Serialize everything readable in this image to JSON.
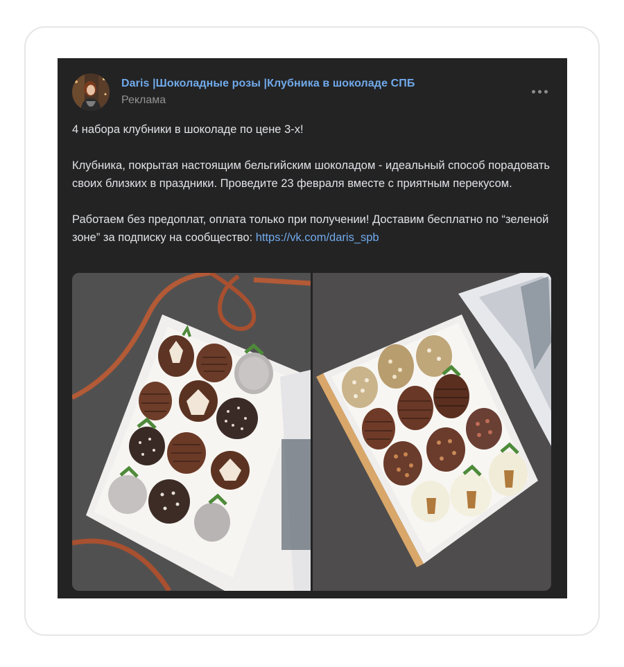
{
  "post": {
    "author": "Daris |Шоколадные розы |Клубника в шоколаде СПБ",
    "ad_label": "Реклама",
    "menu_icon": "more-horizontal-icon",
    "paragraph1": "4 набора клубники в шоколаде по цене 3-х!",
    "paragraph2": "Клубника, покрытая настоящим бельгийским шоколадом - идеальный способ порадовать своих близких в праздники. Проведите 23 февраля вместе с приятным перекусом.",
    "paragraph3_text": "Работаем без предоплат, оплата только при получении! Доставим бесплатно по “зеленой зоне” за подписку на сообщество: ",
    "paragraph3_link": "https://vk.com/daris_spb"
  },
  "colors": {
    "card_bg": "#232324",
    "link": "#71aaeb",
    "text": "#e1e3e6",
    "muted": "#939393"
  }
}
